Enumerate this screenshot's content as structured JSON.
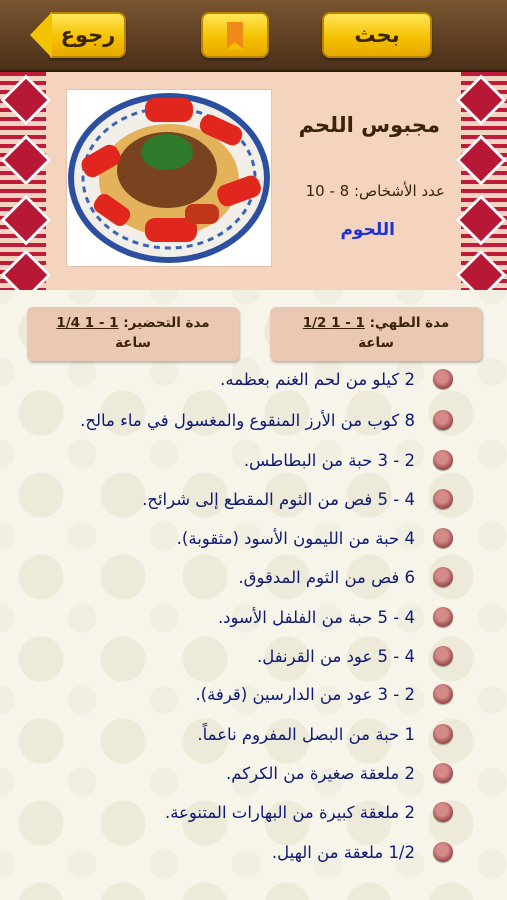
{
  "topbar": {
    "search_label": "بحث",
    "back_label": "رجوع",
    "bookmark_icon": "bookmark-icon"
  },
  "recipe": {
    "title": "مجبوس اللحم",
    "servings": "عدد الأشخاص: 8 - 10",
    "category": "اللحوم",
    "cook_time_label": "مدة الطهي:",
    "cook_time_value": "1 - 1 1/2",
    "cook_time_unit": "ساعة",
    "prep_time_label": "مدة التحضير:",
    "prep_time_value": "1 - 1 1/4",
    "prep_time_unit": "ساعة"
  },
  "ingredients": [
    "2 كيلو من لحم الغنم بعظمه.",
    "8 كوب من الأرز المنقوع والمغسول في ماء مالح.",
    "2 - 3 حبة من البطاطس.",
    "4 - 5 فص من الثوم المقطع إلى شرائح.",
    "4 حبة من الليمون الأسود (مثقوبة).",
    "6 فص من الثوم المدقوق.",
    "4 - 5 حبة من الفلفل الأسود.",
    "4 - 5 عود من القرنفل.",
    "2 - 3 عود من الدارسين (قرفة).",
    "1 حبة من البصل المفروم ناعماً.",
    "2 ملعقة صغيرة من الكركم.",
    "2 ملعقة كبيرة من البهارات المتنوعة.",
    "1/2 ملعقة من الهيل."
  ],
  "colors": {
    "accent_button": "#f5c200",
    "header_bg": "#f4d3bf",
    "ingredient_text": "#0e1b73",
    "category_link": "#1a32d8"
  }
}
